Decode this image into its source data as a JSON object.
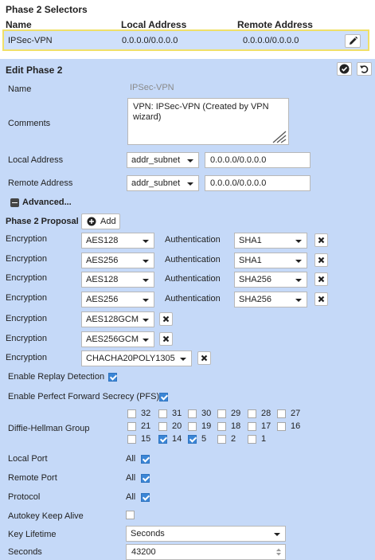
{
  "selectors": {
    "title": "Phase 2 Selectors",
    "columns": [
      "Name",
      "Local Address",
      "Remote Address"
    ],
    "row": {
      "name": "IPSec-VPN",
      "local": "0.0.0.0/0.0.0.0",
      "remote": "0.0.0.0/0.0.0.0"
    },
    "edit_icon": "pencil-icon"
  },
  "edit": {
    "title": "Edit Phase 2",
    "name_label": "Name",
    "name_value": "IPSec-VPN",
    "comments_label": "Comments",
    "comments_value": "VPN: IPSec-VPN (Created by VPN wizard)",
    "local_label": "Local Address",
    "local_type": "addr_subnet",
    "local_value": "0.0.0.0/0.0.0.0",
    "remote_label": "Remote Address",
    "remote_type": "addr_subnet",
    "remote_value": "0.0.0.0/0.0.0.0",
    "advanced_label": "Advanced...",
    "proposal_label": "Phase 2 Proposal",
    "add_label": "Add",
    "encryption_label": "Encryption",
    "authentication_label": "Authentication",
    "proposals": [
      {
        "enc": "AES128",
        "auth": "SHA1"
      },
      {
        "enc": "AES256",
        "auth": "SHA1"
      },
      {
        "enc": "AES128",
        "auth": "SHA256"
      },
      {
        "enc": "AES256",
        "auth": "SHA256"
      },
      {
        "enc": "AES128GCM",
        "auth": ""
      },
      {
        "enc": "AES256GCM",
        "auth": ""
      },
      {
        "enc": "CHACHA20POLY1305",
        "auth": ""
      }
    ],
    "replay_label": "Enable Replay Detection",
    "replay_checked": true,
    "pfs_label": "Enable Perfect Forward Secrecy (PFS)",
    "pfs_checked": true,
    "dh_label": "Diffie-Hellman Group",
    "dh_groups": [
      {
        "value": "32",
        "checked": false
      },
      {
        "value": "31",
        "checked": false
      },
      {
        "value": "30",
        "checked": false
      },
      {
        "value": "29",
        "checked": false
      },
      {
        "value": "28",
        "checked": false
      },
      {
        "value": "27",
        "checked": false
      },
      {
        "value": "21",
        "checked": false
      },
      {
        "value": "20",
        "checked": false
      },
      {
        "value": "19",
        "checked": false
      },
      {
        "value": "18",
        "checked": false
      },
      {
        "value": "17",
        "checked": false
      },
      {
        "value": "16",
        "checked": false
      },
      {
        "value": "15",
        "checked": false
      },
      {
        "value": "14",
        "checked": true
      },
      {
        "value": "5",
        "checked": true
      },
      {
        "value": "2",
        "checked": false
      },
      {
        "value": "1",
        "checked": false
      }
    ],
    "local_port_label": "Local Port",
    "local_port_value": "All",
    "local_port_checked": true,
    "remote_port_label": "Remote Port",
    "remote_port_value": "All",
    "remote_port_checked": true,
    "protocol_label": "Protocol",
    "protocol_value": "All",
    "protocol_checked": true,
    "autokey_label": "Autokey Keep Alive",
    "autokey_checked": false,
    "lifetime_label": "Key Lifetime",
    "lifetime_value": "Seconds",
    "seconds_label": "Seconds",
    "seconds_value": "43200"
  },
  "colors": {
    "panel": "#c5d9f8",
    "selected_row": "#cfe0fb",
    "selected_border": "#f0e068",
    "checkbox": "#3b86d6"
  }
}
